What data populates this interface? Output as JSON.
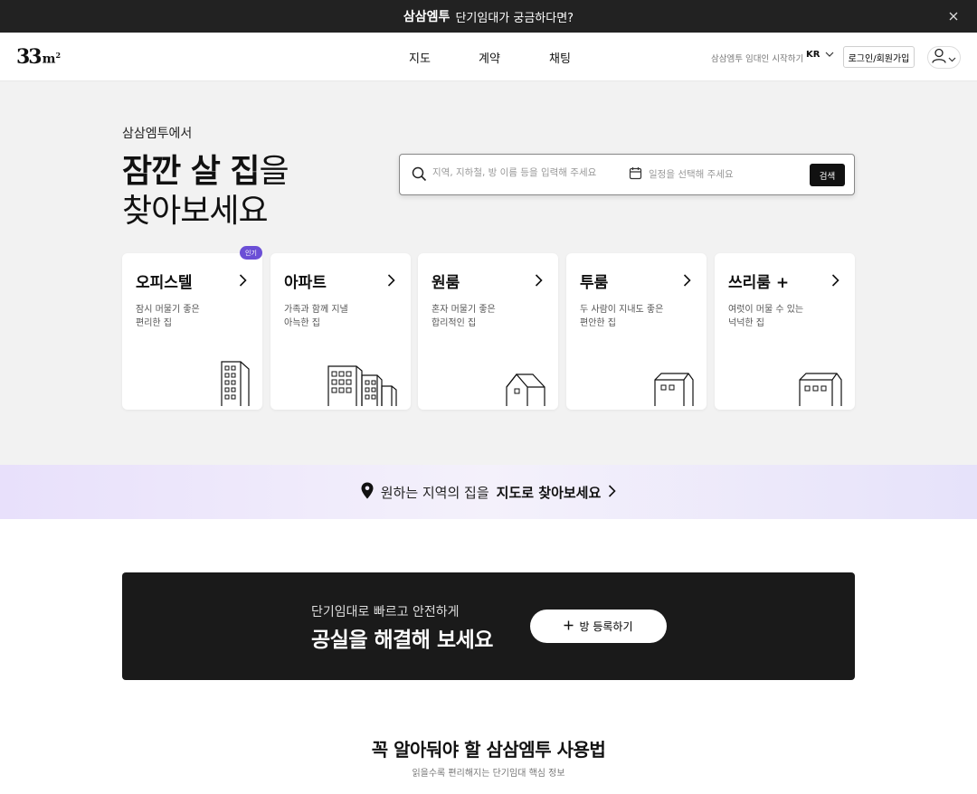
{
  "banner": {
    "brand": "삼삼엠투",
    "message": "단기임대가 궁금하다면?"
  },
  "header": {
    "logo_main": "33",
    "logo_unit": "m",
    "logo_sup": "2",
    "nav": [
      "지도",
      "계약",
      "채팅"
    ],
    "host_link": "삼삼엠투 임대인 시작하기",
    "lang": "KR",
    "login_label": "로그인/회원가입"
  },
  "hero": {
    "eyebrow": "삼삼엠투에서",
    "title_bold": "잠깐 살 집",
    "title_suffix": "을",
    "title_line2": "찾아보세요"
  },
  "search": {
    "placeholder": "지역, 지하철, 방 이름 등을 입력해 주세요",
    "date_placeholder": "일정을 선택해 주세요",
    "button": "검색"
  },
  "categories": [
    {
      "title": "오피스텔",
      "desc1": "잠시 머물기 좋은",
      "desc2": "편리한 집",
      "badge": "인기"
    },
    {
      "title": "아파트",
      "desc1": "가족과 함께 지낼",
      "desc2": "아늑한 집"
    },
    {
      "title": "원룸",
      "desc1": "혼자 머물기 좋은",
      "desc2": "합리적인 집"
    },
    {
      "title": "투룸",
      "desc1": "두 사람이 지내도 좋은",
      "desc2": "편안한 집"
    },
    {
      "title": "쓰리룸 +",
      "desc1": "여럿이 머물 수 있는",
      "desc2": "넉넉한 집"
    }
  ],
  "map_strip": {
    "text": "원하는 지역의 집을",
    "bold": "지도로 찾아보세요"
  },
  "promo": {
    "line1": "단기임대로 빠르고 안전하게",
    "line2": "공실을 해결해 보세요",
    "button": "방 등록하기"
  },
  "guide": {
    "title": "꼭 알아둬야 할 삼삼엠투 사용법",
    "subtitle": "읽을수록 편리해지는 단기임대 핵심 정보"
  }
}
